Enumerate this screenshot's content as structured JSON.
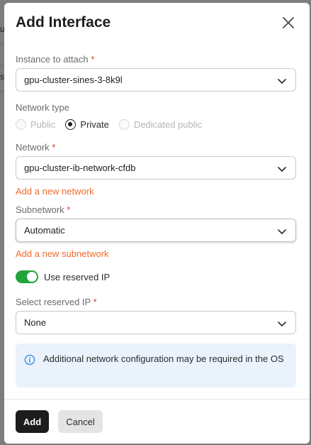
{
  "background": {
    "chars": [
      "u",
      "s"
    ]
  },
  "dialog": {
    "title": "Add Interface",
    "close_icon": "close-icon"
  },
  "instance": {
    "label": "Instance to attach",
    "required_mark": "*",
    "value": "gpu-cluster-sines-3-8k9l"
  },
  "network_type": {
    "label": "Network type",
    "options": [
      {
        "label": "Public",
        "state": "disabled"
      },
      {
        "label": "Private",
        "state": "checked"
      },
      {
        "label": "Dedicated public",
        "state": "disabled"
      }
    ]
  },
  "network": {
    "label": "Network",
    "required_mark": "*",
    "value": "gpu-cluster-ib-network-cfdb",
    "add_link": "Add a new network"
  },
  "subnetwork": {
    "label": "Subnetwork",
    "required_mark": "*",
    "value": "Automatic",
    "add_link": "Add a new subnetwork"
  },
  "reserved_ip": {
    "toggle_label": "Use reserved IP",
    "toggle_on": true,
    "select_label": "Select reserved IP",
    "required_mark": "*",
    "value": "None"
  },
  "info": {
    "text": "Additional network configuration may be required in the OS",
    "icon": "info-icon"
  },
  "footer": {
    "add_label": "Add",
    "cancel_label": "Cancel"
  },
  "colors": {
    "accent_link": "#f26b2a",
    "toggle_on": "#22a33b",
    "required": "#e2372f",
    "info_bg": "#eaf3fc",
    "primary_button": "#1c1c1c"
  }
}
